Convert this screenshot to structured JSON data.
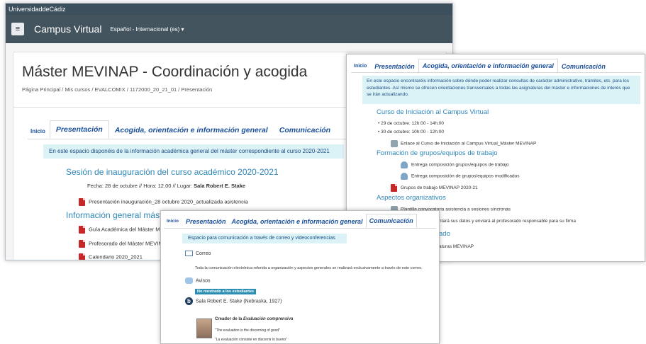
{
  "win1": {
    "brand": "UniversidaddeCádiz",
    "nav_title": "Campus Virtual",
    "language": "Español - Internacional (es) ▾",
    "page_title": "Máster MEVINAP - Coordinación y acogida",
    "breadcrumb": "Página Principal / Mis cursos / EVALCOMIX / 1172000_20_21_01 / Presentación",
    "tabs": {
      "inicio": "Inicio",
      "t1": "Presentación",
      "t2": "Acogida, orientación e información general",
      "t3": "Comunicación"
    },
    "banner": "En este espacio disponéis de la información académica general del máster correspondiente al curso 2020-2021",
    "section1": "Sesión de inauguración del curso académico 2020-2021",
    "session_info_prefix": "Fecha: 28 de octubre // Hora: 12.00 // Lugar: ",
    "session_place": "Sala Robert E. Stake",
    "file1": "Presentación inauguración_28 octubre 2020_actualizada asistencia",
    "section2": "Información general máster",
    "file2": "Guía Académica del Máster MEV",
    "file3": "Profesorado del Máster MEVINA",
    "file4": "Calendario 2020_2021"
  },
  "win2": {
    "tabs": {
      "inicio": "Inicio",
      "t1": "Presentación",
      "t2": "Acogida, orientación e información general",
      "t3": "Comunicación"
    },
    "banner": "En este espacio encontraréis información sobre dónde poder realizar consultas de carácter administrativo, trámites, etc. para los estudiantes. Así mismo se ofrecen orientaciones transversales a todas las asignaturas del máster e informaciones de interés que se irán actualizando.",
    "section1": "Curso de Iniciación al Campus Virtual",
    "bullet1": "29 de octubre: 12h:00 - 14h:00",
    "bullet2": "30 de octubre: 10h:00 - 12h:00",
    "link1": "Enlace al Curso de Iniciación al Campus Virtual_Máster MEVINAP",
    "section2": "Formación de grupos/equipos de trabajo",
    "item1": "Entrega composición grupos/equipos de trabajo",
    "item2": "Entrega composición de grupos/equipos modificados",
    "item3": "Grupos de trabajo MEVINAP 2020-21",
    "section3": "Aspectos organizativos",
    "item4": "Plantilla convocatoria asistencia a sesiones síncronas",
    "item5": "ntará sus datos y enviará al profesorado responsable para su firma",
    "section4": "ado",
    "item6": "aturas MEVINAP"
  },
  "win3": {
    "tabs": {
      "inicio": "Inicio",
      "t1": "Presentación",
      "t2": "Acogida, orientación e información general",
      "t3": "Comunicación"
    },
    "banner": "Espacio para comunicación a través de correo y videoconferencias",
    "mail_label": "Correo",
    "mail_text": "Toda la comunicación electrónica referida a organización y aspectos generales se realizará exclusivamente a través de este correo.",
    "avisos": "Avisos",
    "badge": "No mostrado a los estudiantes",
    "room": "Sala Robert E. Stake (Nebraska, 1927)",
    "creator_prefix": "Creador de la ",
    "creator_em": "Evaluación comprensiva",
    "quote1": "\"The evaluation is the discerning of good\"",
    "quote2": "\"La evaluación consiste en discernir lo bueno\""
  }
}
